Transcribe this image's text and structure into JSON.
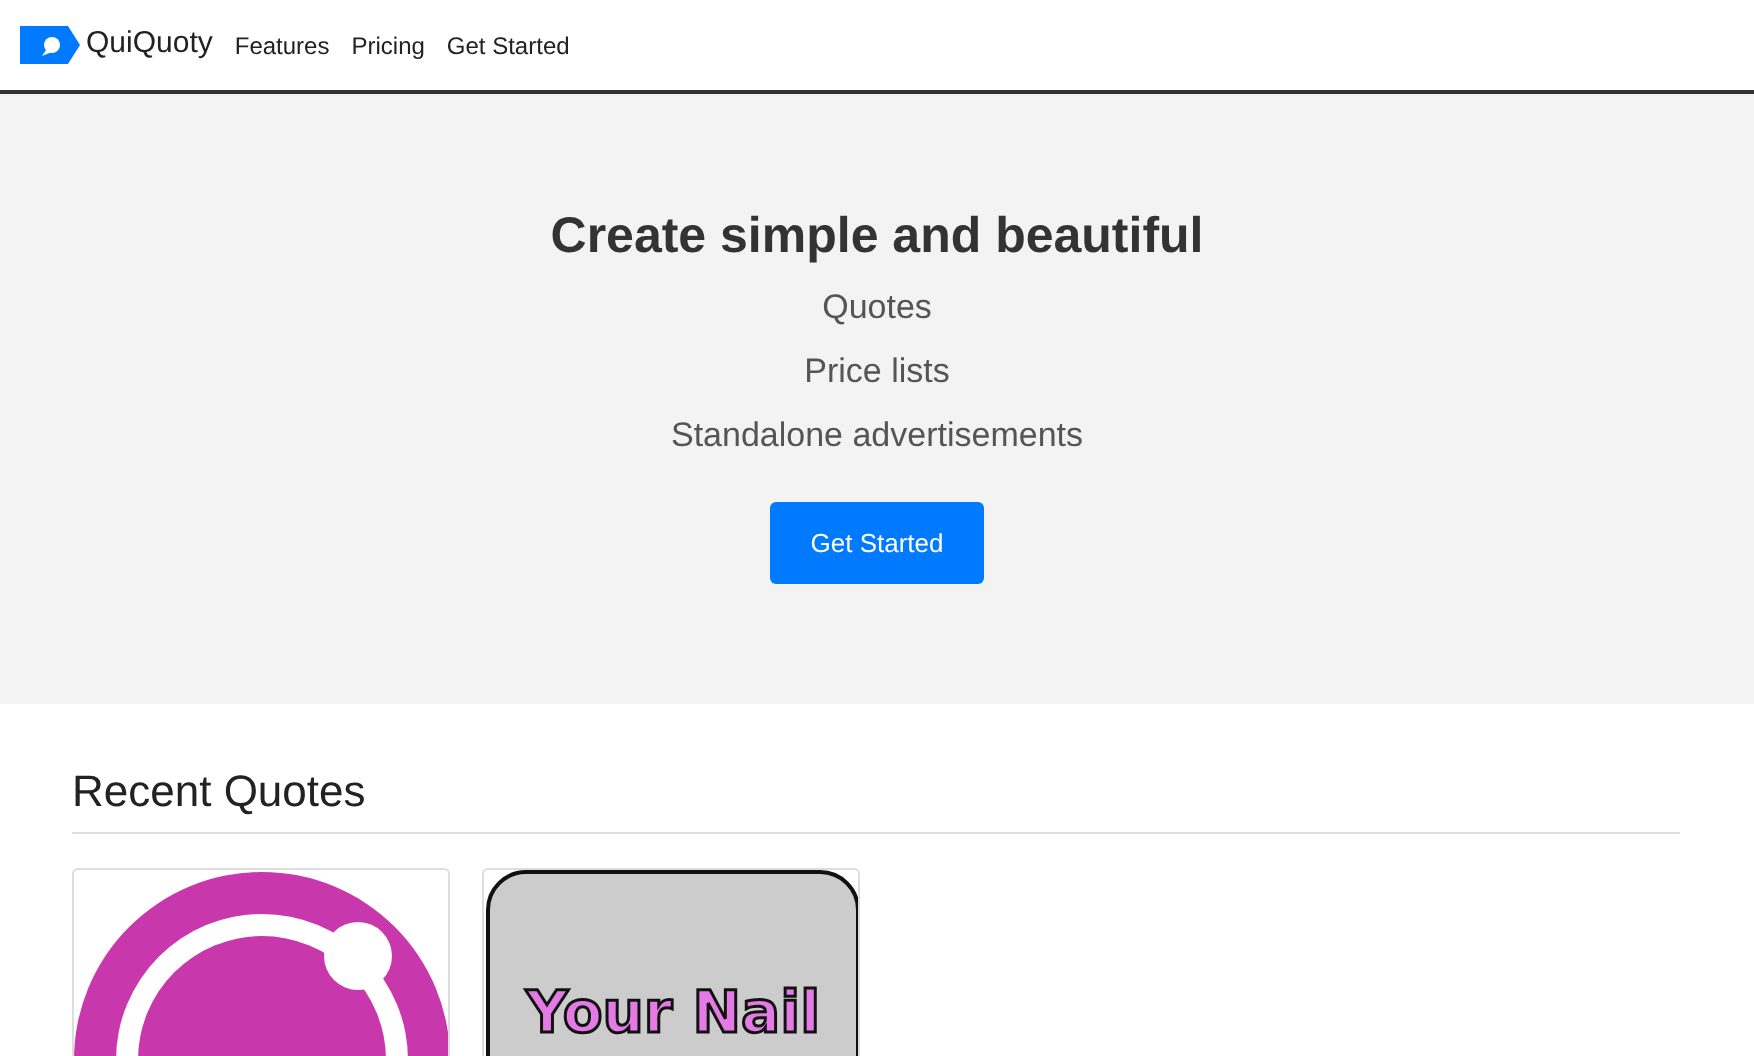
{
  "navbar": {
    "brand": "QuiQuoty",
    "links": [
      {
        "label": "Features"
      },
      {
        "label": "Pricing"
      },
      {
        "label": "Get Started"
      }
    ]
  },
  "hero": {
    "title": "Create simple and beautiful",
    "items": [
      "Quotes",
      "Price lists",
      "Standalone advertisements"
    ],
    "button": "Get Started"
  },
  "recent_quotes": {
    "heading": "Recent Quotes",
    "cards": [
      {
        "kind": "ring"
      },
      {
        "kind": "sign",
        "text": "Your Nail"
      }
    ]
  }
}
